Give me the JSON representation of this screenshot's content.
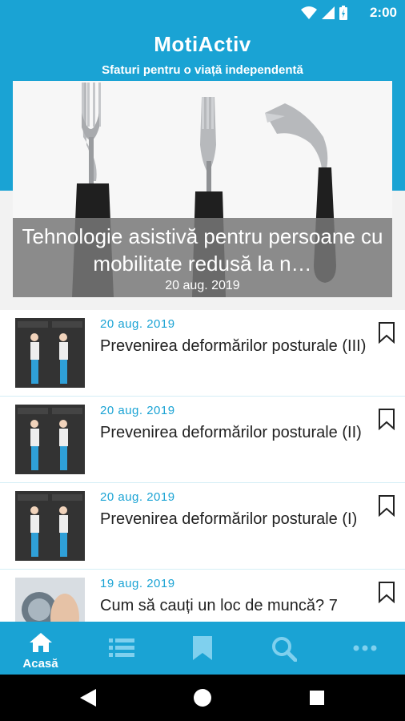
{
  "status_bar": {
    "time": "2:00"
  },
  "header": {
    "title": "MotiActiv",
    "subtitle": "Sfaturi pentru o viață independentă"
  },
  "hero": {
    "title": "Tehnologie asistivă pentru persoane cu mobilitate redusă la n…",
    "date": "20 aug. 2019"
  },
  "articles": [
    {
      "date": "20 aug. 2019",
      "title": "Prevenirea deformărilor posturale (III)"
    },
    {
      "date": "20 aug. 2019",
      "title": "Prevenirea deformărilor posturale (II)"
    },
    {
      "date": "20 aug. 2019",
      "title": "Prevenirea deformărilor posturale (I)"
    },
    {
      "date": "19 aug. 2019",
      "title": "Cum să cauți un loc de muncă? 7"
    }
  ],
  "bottom_nav": {
    "items": [
      {
        "icon": "home-icon",
        "label": "Acasă",
        "active": true
      },
      {
        "icon": "list-icon",
        "label": ""
      },
      {
        "icon": "bookmark-icon",
        "label": ""
      },
      {
        "icon": "search-icon",
        "label": ""
      },
      {
        "icon": "more-icon",
        "label": ""
      }
    ]
  },
  "colors": {
    "primary": "#1aa3d4",
    "date_text": "#1aa3d4",
    "nav_inactive": "#7fd0ee"
  }
}
